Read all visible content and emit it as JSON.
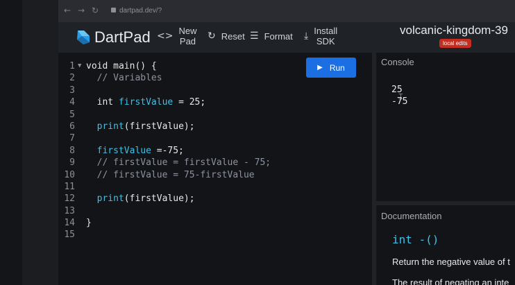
{
  "browser": {
    "url": "dartpad.dev/?",
    "nav_back": "←",
    "nav_forward": "→",
    "nav_reload": "↻"
  },
  "header": {
    "brand": "DartPad",
    "new_pad_label": "New\nPad",
    "new_pad_icon": "code-icon",
    "reset_label": "Reset",
    "reset_icon": "refresh-icon",
    "format_label": "Format",
    "format_icon": "format-align-icon",
    "install_label": "Install\nSDK",
    "install_icon": "download-icon",
    "pad_title": "volcanic-kingdom-39",
    "badge": "local edits",
    "accent": "#1c6fe3",
    "badge_color": "#c62d1f"
  },
  "editor": {
    "run_label": "Run",
    "lines": [
      {
        "n": "1",
        "parts": [
          [
            "txt",
            "void main() {"
          ]
        ],
        "fold": true
      },
      {
        "n": "2",
        "parts": [
          [
            "cm",
            "  // Variables"
          ]
        ]
      },
      {
        "n": "3",
        "parts": []
      },
      {
        "n": "4",
        "parts": [
          [
            "txt",
            "  int "
          ],
          [
            "vr",
            "firstValue"
          ],
          [
            "txt",
            " = 25;"
          ]
        ]
      },
      {
        "n": "5",
        "parts": []
      },
      {
        "n": "6",
        "parts": [
          [
            "vr",
            "  print"
          ],
          [
            "txt",
            "(firstValue);"
          ]
        ]
      },
      {
        "n": "7",
        "parts": []
      },
      {
        "n": "8",
        "parts": [
          [
            "vr",
            "  firstValue"
          ],
          [
            "txt",
            " =-75;"
          ]
        ]
      },
      {
        "n": "9",
        "parts": [
          [
            "cm",
            "  // firstValue = firstValue - 75;"
          ]
        ]
      },
      {
        "n": "10",
        "parts": [
          [
            "cm",
            "  // firstValue = 75-firstValue"
          ]
        ]
      },
      {
        "n": "11",
        "parts": []
      },
      {
        "n": "12",
        "parts": [
          [
            "vr",
            "  print"
          ],
          [
            "txt",
            "(firstValue);"
          ]
        ]
      },
      {
        "n": "13",
        "parts": []
      },
      {
        "n": "14",
        "parts": [
          [
            "txt",
            "}"
          ]
        ]
      },
      {
        "n": "15",
        "parts": []
      }
    ]
  },
  "console": {
    "title": "Console",
    "output": "25\n-75"
  },
  "docs": {
    "title": "Documentation",
    "signature": "int -()",
    "p1": "Return the negative value of t",
    "p2": "The result of negating an inte"
  }
}
